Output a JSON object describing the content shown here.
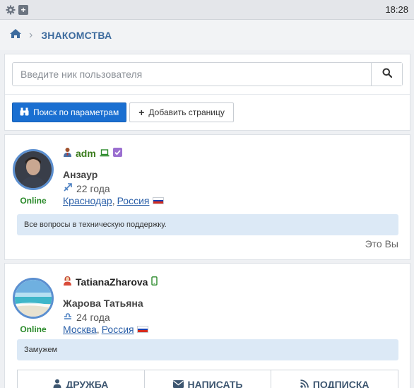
{
  "statusbar": {
    "time": "18:28",
    "icons": [
      "gear-icon",
      "plus-square-icon"
    ]
  },
  "breadcrumb": {
    "home_icon": "home-icon",
    "separator_icon": "chevron-right-icon",
    "current": "ЗНАКОМСТВА"
  },
  "search": {
    "placeholder": "Введите ник пользователя",
    "value": "",
    "button_icon": "search-icon"
  },
  "buttons": {
    "search_params": "Поиск по параметрам",
    "add_page": "Добавить страницу"
  },
  "users": [
    {
      "nick": "adm",
      "nick_color": "#3c7d1e",
      "real_name": "Анзаур",
      "age": "22 года",
      "city": "Краснодар",
      "country": "Россия",
      "online": "Online",
      "status": "Все вопросы в техническую поддержку.",
      "note": "Это Вы",
      "gender_icon": "male-user-icon",
      "device_icon": "laptop-icon",
      "zodiac_icon": "sagittarius-icon"
    },
    {
      "nick": "TatianaZharova",
      "nick_color": "#222222",
      "real_name": "Жарова Татьяна",
      "age": "24 года",
      "city": "Москва",
      "country": "Россия",
      "online": "Online",
      "status": "Замужем",
      "gender_icon": "female-user-icon",
      "device_icon": "mobile-icon",
      "zodiac_icon": "libra-icon"
    }
  ],
  "actions": {
    "friend": "ДРУЖБА",
    "write": "НАПИСАТЬ",
    "subscribe": "ПОДПИСКА"
  },
  "colors": {
    "accent": "#1a6fd1",
    "link": "#2a5fa8",
    "online": "#2a8a2a",
    "status_bg": "#dce9f6"
  }
}
